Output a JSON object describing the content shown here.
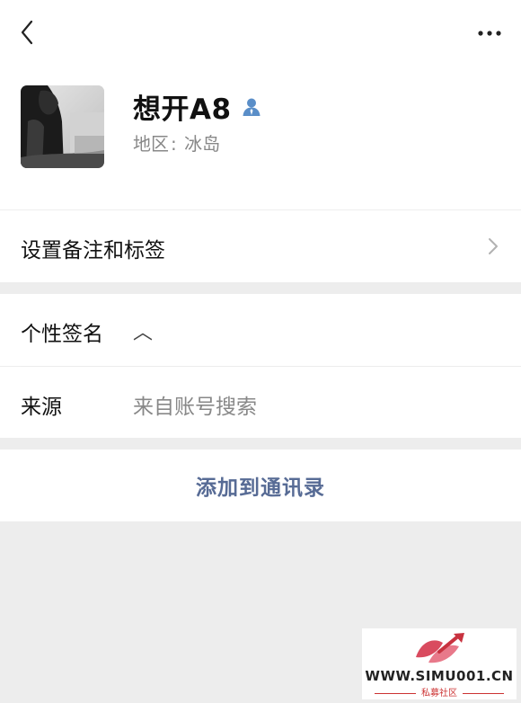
{
  "header": {
    "back_icon": "chevron-left-icon",
    "more_icon": "more-horizontal-icon"
  },
  "profile": {
    "name": "想开A8",
    "verified_icon": "person-icon",
    "region_label": "地区",
    "region_separator": ":",
    "region_value": "冰岛"
  },
  "rows": {
    "remark_label": "设置备注和标签",
    "signature_label": "个性签名",
    "signature_value": "︿",
    "source_label": "来源",
    "source_value": "来自账号搜索"
  },
  "actions": {
    "add_contact": "添加到通讯录"
  },
  "watermark": {
    "url": "WWW.SIMU001.CN",
    "subtitle": "私募社区"
  },
  "colors": {
    "link_blue": "#576b95",
    "secondary_text": "#888888",
    "page_bg": "#ededed",
    "verified_icon": "#5a8ec8",
    "watermark_red": "#cc3333"
  }
}
